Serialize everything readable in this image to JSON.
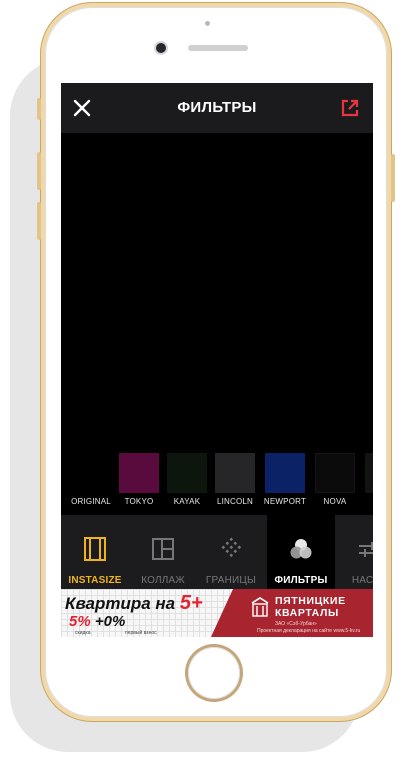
{
  "header": {
    "title": "ФИЛЬТРЫ"
  },
  "filters": [
    {
      "label": "ORIGINAL",
      "color": "#000000"
    },
    {
      "label": "TOKYO",
      "color": "#5a0b3e"
    },
    {
      "label": "KAYAK",
      "color": "#0c160c"
    },
    {
      "label": "LINCOLN",
      "color": "#262628"
    },
    {
      "label": "NEWPORT",
      "color": "#0b2266"
    },
    {
      "label": "NOVA",
      "color": "#0b0b0b"
    }
  ],
  "toolbar": {
    "tools": [
      {
        "label": "INSTASIZE",
        "icon": "frame-icon"
      },
      {
        "label": "КОЛЛАЖ",
        "icon": "collage-icon"
      },
      {
        "label": "ГРАНИЦЫ",
        "icon": "borders-icon"
      },
      {
        "label": "ФИЛЬТРЫ",
        "icon": "filters-icon",
        "active": true
      },
      {
        "label": "НАСТР",
        "icon": "adjust-icon"
      }
    ]
  },
  "ad": {
    "headline_part1": "Квартира на ",
    "headline_part2": "5+",
    "percent_part1": "5%",
    "percent_part2": "+0%",
    "small_left": "скидка",
    "small_mid": "первый взнос",
    "brand_line1": "ПЯТНИЦКИЕ",
    "brand_line2": "КВАРТАЛЫ",
    "company": "ЗАО «Сэб-Урбан»",
    "declaration": "Проектная декларация на сайте www.5-kv.ru"
  },
  "colors": {
    "accent": "#f0b320",
    "export_red": "#e8353f",
    "ad_red": "#a8242f"
  }
}
